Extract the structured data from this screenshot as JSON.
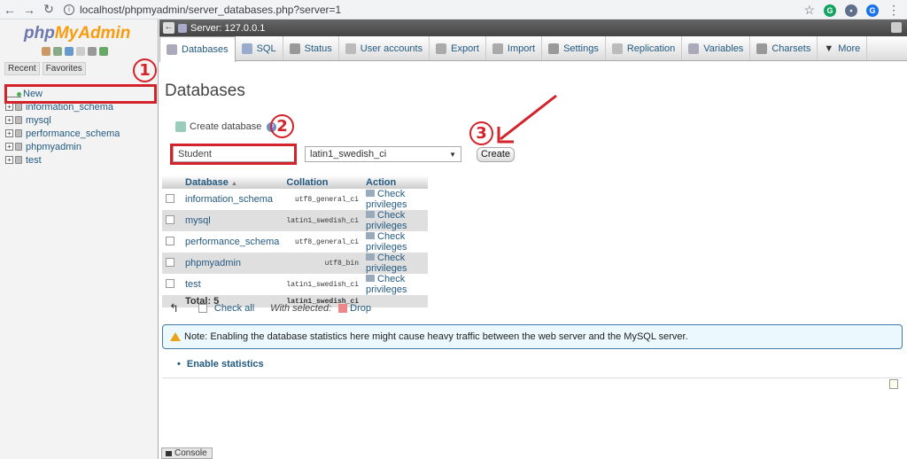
{
  "browser": {
    "url": "localhost/phpmyadmin/server_databases.php?server=1",
    "profile_initial": "G"
  },
  "logo": {
    "php": "php",
    "my": "My",
    "admin": "Admin"
  },
  "left_tabs": [
    "Recent",
    "Favorites"
  ],
  "tree": {
    "new_label": "New",
    "databases": [
      "information_schema",
      "mysql",
      "performance_schema",
      "phpmyadmin",
      "test"
    ]
  },
  "server_bar": {
    "label": "Server: 127.0.0.1"
  },
  "tabs": [
    "Databases",
    "SQL",
    "Status",
    "User accounts",
    "Export",
    "Import",
    "Settings",
    "Replication",
    "Variables",
    "Charsets",
    "More"
  ],
  "page": {
    "title": "Databases",
    "create_label": "Create database",
    "help_glyph": "?",
    "db_name_value": "Student",
    "collation_value": "latin1_swedish_ci",
    "create_button": "Create"
  },
  "table": {
    "headers": {
      "database": "Database",
      "collation": "Collation",
      "action": "Action"
    },
    "rows": [
      {
        "name": "information_schema",
        "collation": "utf8_general_ci",
        "action": "Check privileges"
      },
      {
        "name": "mysql",
        "collation": "latin1_swedish_ci",
        "action": "Check privileges"
      },
      {
        "name": "performance_schema",
        "collation": "utf8_general_ci",
        "action": "Check privileges"
      },
      {
        "name": "phpmyadmin",
        "collation": "utf8_bin",
        "action": "Check privileges"
      },
      {
        "name": "test",
        "collation": "latin1_swedish_ci",
        "action": "Check privileges"
      }
    ],
    "total_label": "Total: 5",
    "total_collation": "latin1_swedish_ci"
  },
  "bulk": {
    "check_all": "Check all",
    "with_selected": "With selected:",
    "drop": "Drop"
  },
  "notice": "Note: Enabling the database statistics here might cause heavy traffic between the web server and the MySQL server.",
  "enable_statistics": "Enable statistics",
  "console": "Console",
  "annotations": [
    "1",
    "2",
    "3"
  ],
  "colors": {
    "annotation_red": "#d3222a",
    "link_blue": "#235a81"
  }
}
